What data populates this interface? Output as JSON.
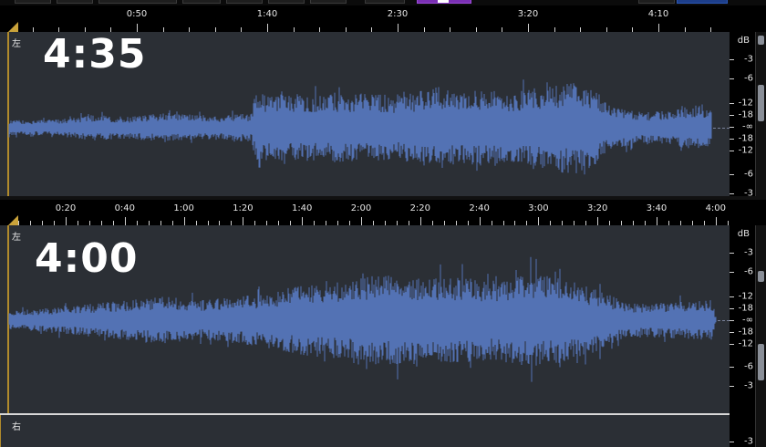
{
  "top_ruler": {
    "labels": [
      "0:50",
      "1:40",
      "2:30",
      "3:20",
      "4:10"
    ]
  },
  "bottom_ruler": {
    "labels": [
      "0:20",
      "0:40",
      "1:00",
      "1:20",
      "1:40",
      "2:00",
      "2:20",
      "2:40",
      "3:00",
      "3:20",
      "3:40",
      "4:00"
    ]
  },
  "top_track": {
    "channel": "左",
    "duration_overlay": "4:35"
  },
  "bottom_track": {
    "channel": "左",
    "duration_overlay": "4:00"
  },
  "right_channel": {
    "label": "右"
  },
  "db_scale_top": {
    "unit": "dB",
    "labels": [
      "-3",
      "-6",
      "-12",
      "-18",
      "-∞",
      "-18",
      "-12",
      "-6",
      "-3"
    ]
  },
  "db_scale_bottom": {
    "unit": "dB",
    "labels": [
      "-3",
      "-6",
      "-12",
      "-18",
      "-∞",
      "-18",
      "-12",
      "-6",
      "-3"
    ],
    "extra_label": "-3"
  },
  "colors": {
    "waveform": "#5372b4",
    "track_bg": "#2b2f35",
    "playhead": "#b08a2c",
    "accent_purple": "#7a2fb4",
    "accent_blue": "#1d3e8a"
  }
}
